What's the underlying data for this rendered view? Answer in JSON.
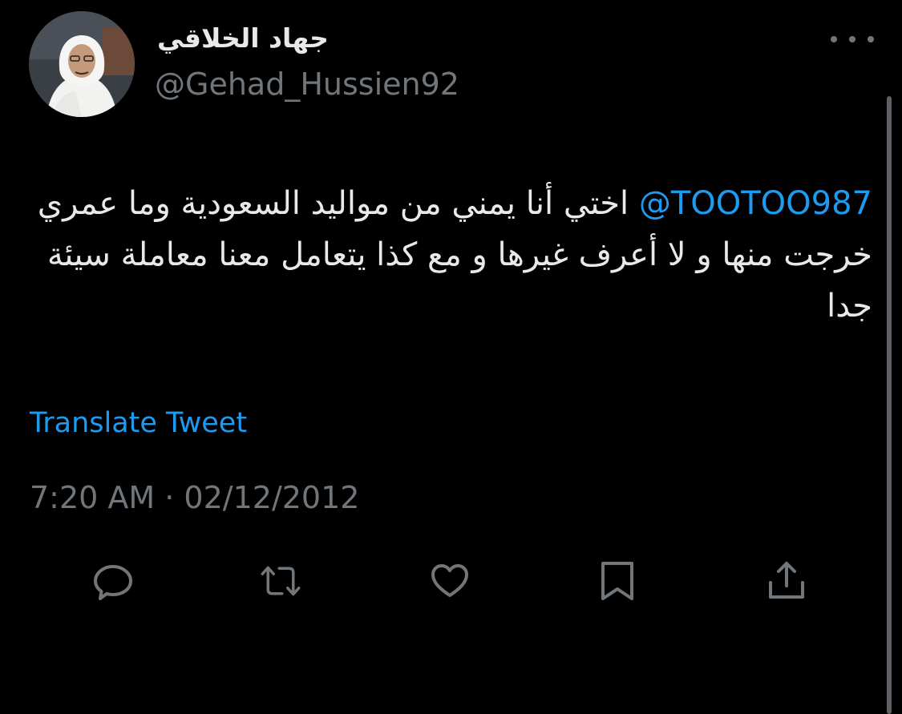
{
  "author": {
    "display_name": "جهاد الخلاقي",
    "handle": "@Gehad_Hussien92"
  },
  "tweet": {
    "mention": "@TOOTOO987",
    "text": " اختي أنا يمني من مواليد السعودية وما عمري خرجت منها و لا أعرف غيرها و مع كذا يتعامل معنا معاملة سيئة جدا",
    "translate_label": "Translate Tweet",
    "timestamp": "7:20 AM · 02/12/2012"
  },
  "actions": [
    {
      "name": "reply",
      "icon": "speech-bubble-icon"
    },
    {
      "name": "retweet",
      "icon": "retweet-icon"
    },
    {
      "name": "like",
      "icon": "heart-icon"
    },
    {
      "name": "bookmark",
      "icon": "bookmark-icon"
    },
    {
      "name": "share",
      "icon": "share-icon"
    }
  ],
  "colors": {
    "background": "#000000",
    "primary_text": "#e7e9ea",
    "secondary_text": "#71767b",
    "accent": "#1d9bf0"
  }
}
